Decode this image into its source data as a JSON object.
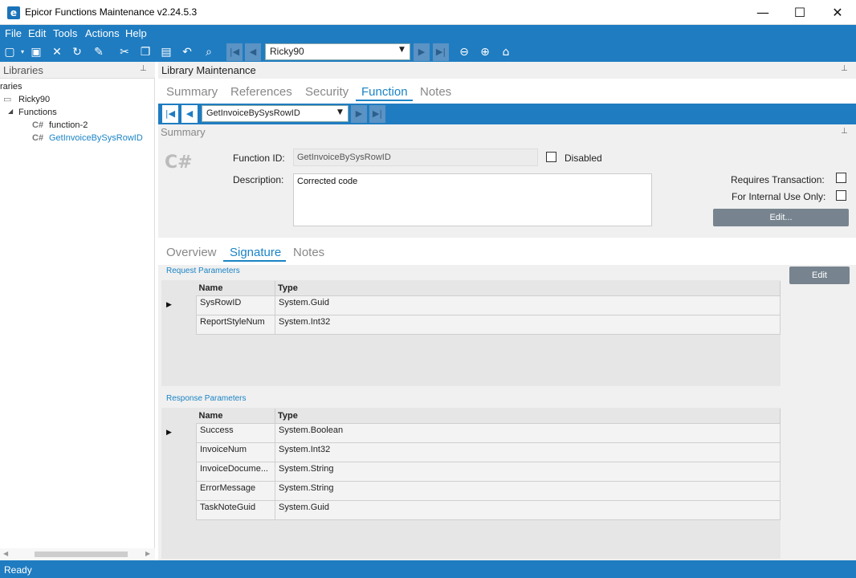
{
  "window": {
    "title": "Epicor Functions Maintenance v2.24.5.3",
    "icon_letter": "e",
    "minimize": "—",
    "maximize": "☐",
    "close": "✕"
  },
  "menu": [
    "File",
    "Edit",
    "Tools",
    "Actions",
    "Help"
  ],
  "toolbar": {
    "record_value": "Ricky90"
  },
  "libraries": {
    "title": "Libraries",
    "tree": {
      "root_label": "raries",
      "library": "Ricky90",
      "functions_label": "Functions",
      "items": [
        "function-2",
        "GetInvoiceBySysRowID"
      ],
      "cs_glyph": "C#"
    }
  },
  "library_maintenance": {
    "title": "Library Maintenance",
    "tabs": [
      "Summary",
      "References",
      "Security",
      "Function",
      "Notes"
    ],
    "active_tab": "Function",
    "function_selector": "GetInvoiceBySysRowID"
  },
  "summary": {
    "title": "Summary",
    "cs_glyph": "C#",
    "function_id_label": "Function ID:",
    "function_id_value": "GetInvoiceBySysRowID",
    "disabled_label": "Disabled",
    "description_label": "Description:",
    "description_value": "Corrected code",
    "requires_transaction_label": "Requires Transaction:",
    "internal_use_label": "For Internal Use Only:",
    "edit_button": "Edit..."
  },
  "sub_tabs": [
    "Overview",
    "Signature",
    "Notes"
  ],
  "active_sub_tab": "Signature",
  "signature": {
    "edit_button": "Edit",
    "request": {
      "title": "Request Parameters",
      "headers": [
        "Name",
        "Type"
      ],
      "rows": [
        [
          "SysRowID",
          "System.Guid"
        ],
        [
          "ReportStyleNum",
          "System.Int32"
        ]
      ]
    },
    "response": {
      "title": "Response Parameters",
      "headers": [
        "Name",
        "Type"
      ],
      "rows": [
        [
          "Success",
          "System.Boolean"
        ],
        [
          "InvoiceNum",
          "System.Int32"
        ],
        [
          "InvoiceDocume...",
          "System.String"
        ],
        [
          "ErrorMessage",
          "System.String"
        ],
        [
          "TaskNoteGuid",
          "System.Guid"
        ]
      ]
    }
  },
  "status": "Ready"
}
